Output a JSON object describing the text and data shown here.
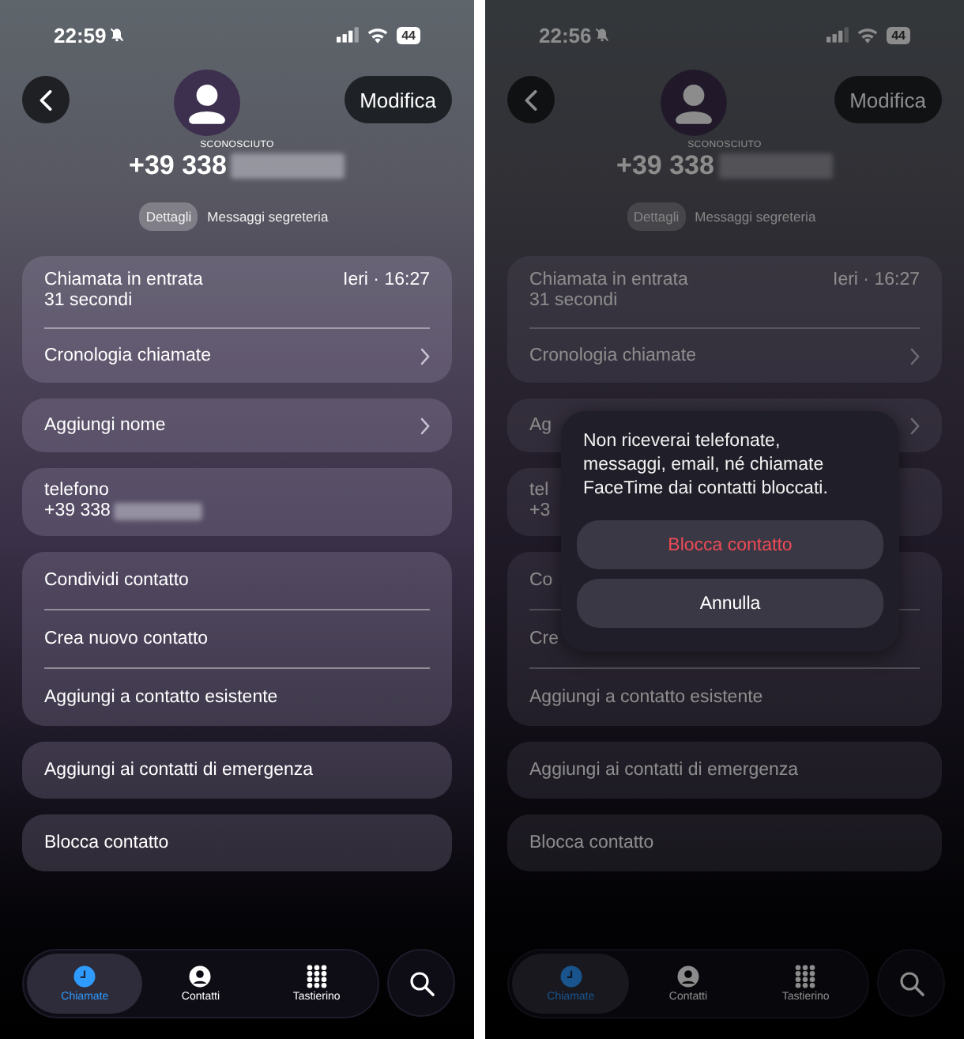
{
  "screens": [
    {
      "status": {
        "time": "22:59",
        "battery": "44"
      },
      "dimmed": false,
      "header": {
        "edit_button": "Modifica",
        "caption": "SCONOSCIUTO",
        "number": "+39 338",
        "redacted": true
      },
      "segments": [
        {
          "label": "Dettagli",
          "selected": true
        },
        {
          "label": "Messaggi segreteria",
          "selected": false
        }
      ],
      "groups": [
        [
          {
            "kind": "call",
            "title": "Chiamata in entrata",
            "time": "Ieri · 16:27",
            "detail": "31 secondi"
          },
          {
            "kind": "nav",
            "label": "Cronologia chiamate"
          }
        ],
        [
          {
            "kind": "nav",
            "label": "Aggiungi nome"
          }
        ],
        [
          {
            "kind": "field",
            "label": "telefono",
            "value": "+39 338",
            "redacted": true
          }
        ],
        [
          {
            "kind": "action",
            "label": "Condividi contatto"
          },
          {
            "kind": "action",
            "label": "Crea nuovo contatto"
          },
          {
            "kind": "action",
            "label": "Aggiungi a contatto esistente"
          }
        ],
        [
          {
            "kind": "action",
            "label": "Aggiungi ai contatti di emergenza"
          }
        ],
        [
          {
            "kind": "action",
            "label": "Blocca contatto"
          }
        ]
      ],
      "tab_bar": [
        {
          "label": "Chiamate",
          "kind": "clock",
          "selected": true
        },
        {
          "label": "Contatti",
          "kind": "person",
          "selected": false
        },
        {
          "label": "Tastierino",
          "kind": "keypad",
          "selected": false
        }
      ]
    },
    {
      "status": {
        "time": "22:56",
        "battery": "44"
      },
      "dimmed": true,
      "header": {
        "edit_button": "Modifica",
        "caption": "SCONOSCIUTO",
        "number": "+39 338",
        "redacted": true
      },
      "segments": [
        {
          "label": "Dettagli",
          "selected": true
        },
        {
          "label": "Messaggi segreteria",
          "selected": false
        }
      ],
      "groups": [
        [
          {
            "kind": "call",
            "title": "Chiamata in entrata",
            "time": "Ieri · 16:27",
            "detail": "31 secondi"
          },
          {
            "kind": "nav",
            "label": "Cronologia chiamate"
          }
        ],
        [
          {
            "kind": "nav",
            "label": "Ag"
          }
        ],
        [
          {
            "kind": "field",
            "label": "tel",
            "value": "+3",
            "redacted": false
          }
        ],
        [
          {
            "kind": "action",
            "label": "Co"
          },
          {
            "kind": "action",
            "label": "Cre"
          },
          {
            "kind": "action",
            "label": "Aggiungi a contatto esistente"
          }
        ],
        [
          {
            "kind": "action",
            "label": "Aggiungi ai contatti di emergenza"
          }
        ],
        [
          {
            "kind": "action",
            "label": "Blocca contatto"
          }
        ]
      ],
      "tab_bar": [
        {
          "label": "Chiamate",
          "kind": "clock",
          "selected": true
        },
        {
          "label": "Contatti",
          "kind": "person",
          "selected": false
        },
        {
          "label": "Tastierino",
          "kind": "keypad",
          "selected": false
        }
      ],
      "dialog": {
        "message": "Non riceverai telefonate, messaggi, email, né chiamate FaceTime dai contatti bloccati.",
        "buttons": [
          {
            "label": "Blocca contatto",
            "kind": "destructive"
          },
          {
            "label": "Annulla",
            "kind": "cancel"
          }
        ]
      }
    }
  ]
}
